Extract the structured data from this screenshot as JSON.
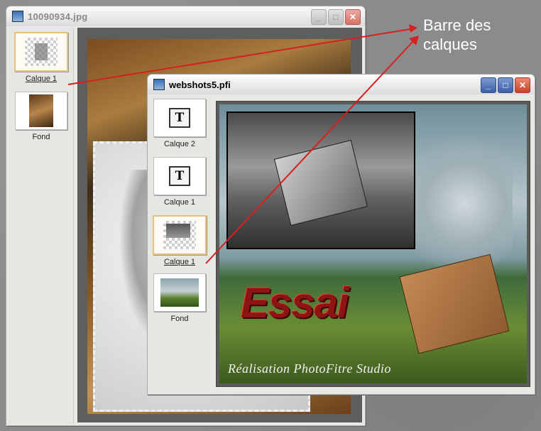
{
  "annotation": {
    "line1": "Barre des",
    "line2": "calques"
  },
  "window_back": {
    "title": "10090934.jpg",
    "layers": [
      {
        "label": "Calque 1",
        "selected": true,
        "thumb": "checker-with-image"
      },
      {
        "label": "Fond",
        "selected": false,
        "thumb": "photo"
      }
    ]
  },
  "window_front": {
    "title": "webshots5.pfi",
    "layers": [
      {
        "label": "Calque 2",
        "selected": false,
        "thumb": "text-layer"
      },
      {
        "label": "Calque 1",
        "selected": false,
        "thumb": "text-layer"
      },
      {
        "label": "Calque 1",
        "selected": true,
        "thumb": "checker-with-image"
      },
      {
        "label": "Fond",
        "selected": false,
        "thumb": "photo"
      }
    ],
    "canvas_text": {
      "title": "Essai",
      "caption": "Réalisation PhotoFitre Studio"
    }
  },
  "icons": {
    "text_layer_glyph": "T",
    "minimize": "minimize-icon",
    "maximize": "maximize-icon",
    "close": "close-icon"
  },
  "colors": {
    "arrow": "#d81f1f",
    "essai_text": "#8e1414"
  }
}
